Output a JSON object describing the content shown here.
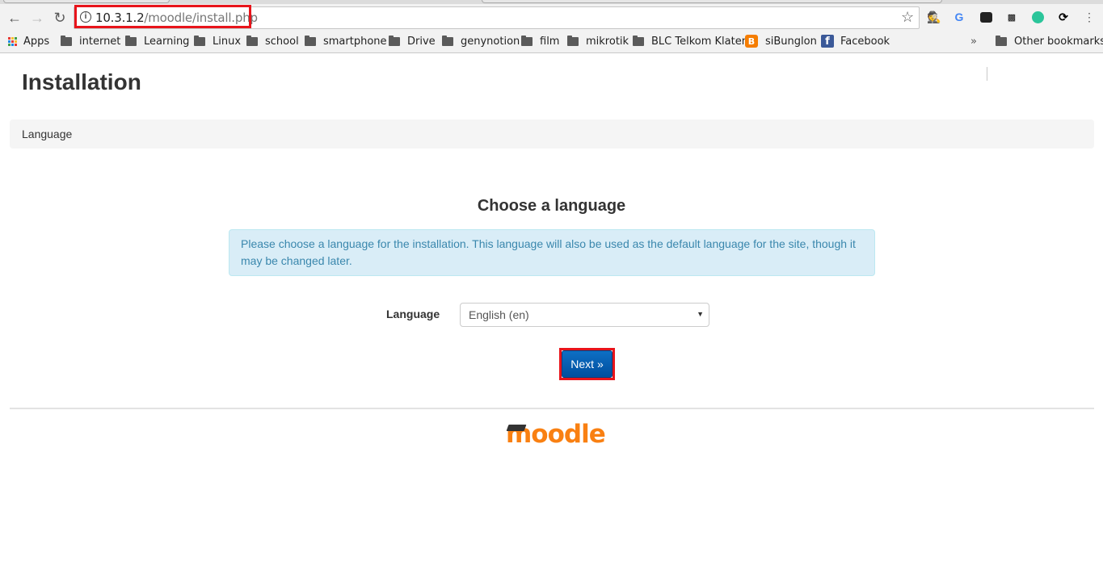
{
  "browser": {
    "url_host": "10.3.1.2",
    "url_path": "/moodle/install.php",
    "bookmarks": [
      {
        "label": "Apps",
        "icon": "apps-grid-icon"
      },
      {
        "label": "internet",
        "icon": "folder-icon"
      },
      {
        "label": "Learning",
        "icon": "folder-icon"
      },
      {
        "label": "Linux",
        "icon": "folder-icon"
      },
      {
        "label": "school",
        "icon": "folder-icon"
      },
      {
        "label": "smartphone",
        "icon": "folder-icon"
      },
      {
        "label": "Drive",
        "icon": "folder-icon"
      },
      {
        "label": "genynotion",
        "icon": "folder-icon"
      },
      {
        "label": "film",
        "icon": "folder-icon"
      },
      {
        "label": "mikrotik",
        "icon": "folder-icon"
      },
      {
        "label": "BLC Telkom Klaten",
        "icon": "folder-icon"
      },
      {
        "label": "siBunglon",
        "icon": "blogger-icon"
      },
      {
        "label": "Facebook",
        "icon": "facebook-icon"
      }
    ],
    "overflow_label": "»",
    "other_bookmarks": "Other bookmarks"
  },
  "page": {
    "title": "Installation",
    "breadcrumb": "Language",
    "heading": "Choose a language",
    "notice": "Please choose a language for the installation. This language will also be used as the default language for the site, though it may be changed later.",
    "language_label": "Language",
    "language_selected": "English (en)",
    "next_label": "Next »",
    "logo_text": "moodle"
  }
}
